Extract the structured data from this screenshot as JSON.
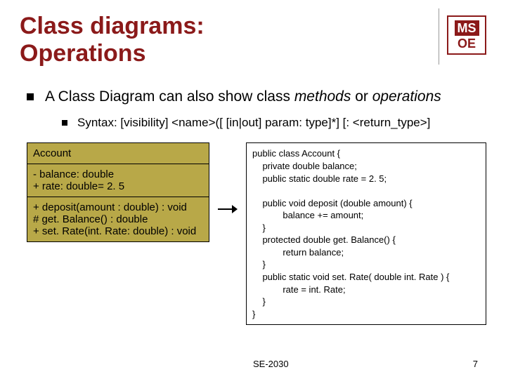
{
  "title": "Class diagrams:\nOperations",
  "logo": {
    "top": "MS",
    "bottom": "OE"
  },
  "bullet1_prefix": "A Class Diagram can also show class ",
  "bullet1_em1": "methods",
  "bullet1_mid": " or ",
  "bullet1_em2": "operations",
  "bullet2": "Syntax: [visibility] <name>([ [in|out] param: type]*] [: <return_type>]",
  "uml": {
    "title": "Account",
    "attrs": "- balance: double\n+ rate: double= 2. 5",
    "ops": "+ deposit(amount : double) : void\n# get. Balance() : double\n+ set. Rate(int. Rate: double) : void"
  },
  "code": "public class Account {\n    private double balance;\n    public static double rate = 2. 5;\n\n    public void deposit (double amount) {\n            balance += amount;\n    }\n    protected double get. Balance() {\n            return balance;\n    }\n    public static void set. Rate( double int. Rate ) {\n            rate = int. Rate;\n    }\n}",
  "footer": {
    "course": "SE-2030",
    "page": "7"
  }
}
